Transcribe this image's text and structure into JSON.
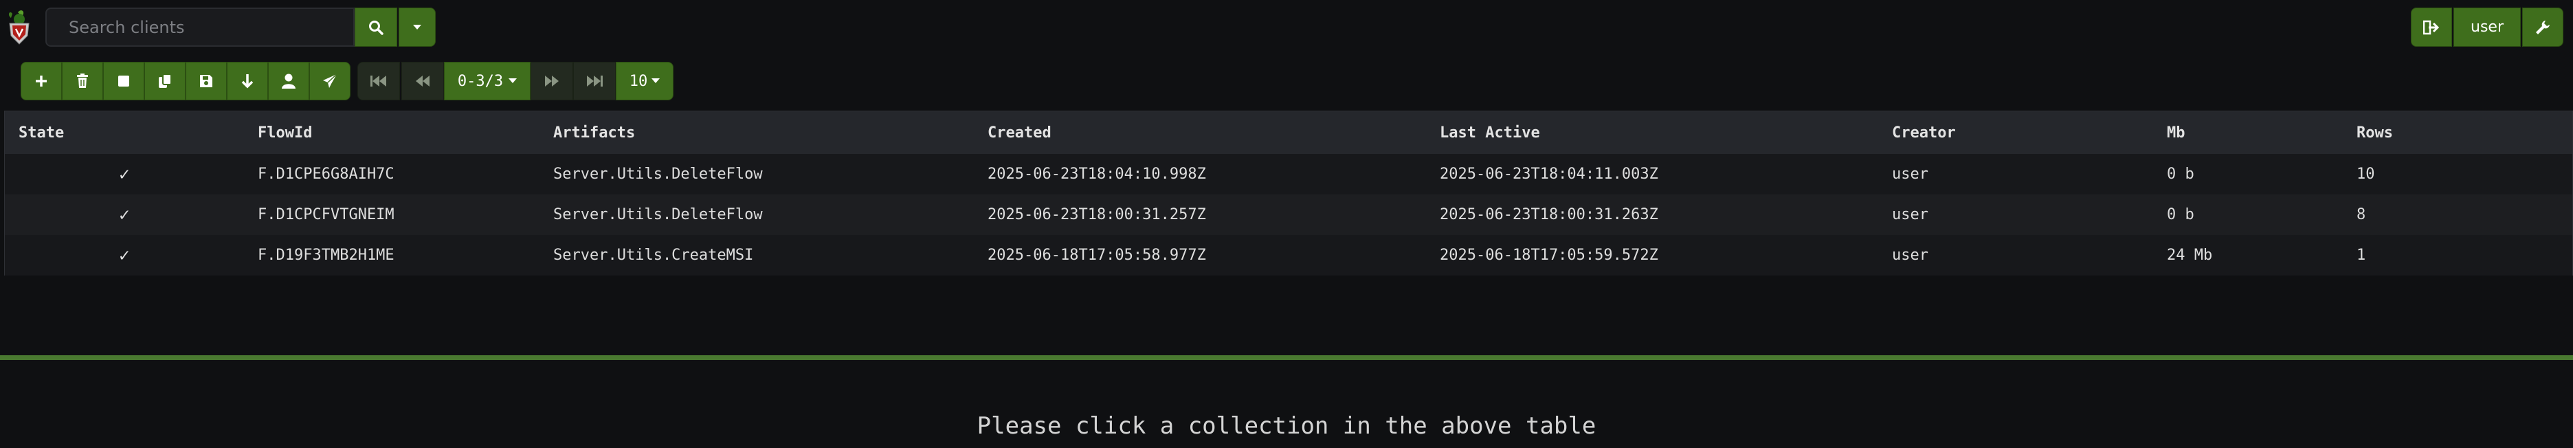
{
  "app": {
    "logo": "velociraptor-logo"
  },
  "search": {
    "placeholder": "Search clients"
  },
  "user": {
    "label": "user"
  },
  "pager": {
    "range": "0-3/3",
    "page_size": "10"
  },
  "table": {
    "columns": [
      "State",
      "FlowId",
      "Artifacts",
      "Created",
      "Last Active",
      "Creator",
      "Mb",
      "Rows"
    ],
    "rows": [
      {
        "state": "✓",
        "flow_id": "F.D1CPE6G8AIH7C",
        "artifacts": "Server.Utils.DeleteFlow",
        "created": "2025-06-23T18:04:10.998Z",
        "last_active": "2025-06-23T18:04:11.003Z",
        "creator": "user",
        "mb": "0 b",
        "rows": "10"
      },
      {
        "state": "✓",
        "flow_id": "F.D1CPCFVTGNEIM",
        "artifacts": "Server.Utils.DeleteFlow",
        "created": "2025-06-23T18:00:31.257Z",
        "last_active": "2025-06-23T18:00:31.263Z",
        "creator": "user",
        "mb": "0 b",
        "rows": "8"
      },
      {
        "state": "✓",
        "flow_id": "F.D19F3TMB2H1ME",
        "artifacts": "Server.Utils.CreateMSI",
        "created": "2025-06-18T17:05:58.977Z",
        "last_active": "2025-06-18T17:05:59.572Z",
        "creator": "user",
        "mb": "24 Mb",
        "rows": "1"
      }
    ]
  },
  "detail": {
    "message": "Please click a collection in the above table"
  },
  "colors": {
    "accent": "#3f6e1c",
    "divider": "#4a7a30",
    "background": "#0f1012"
  },
  "icons": [
    "search-icon",
    "chevron-down-icon",
    "sign-out-icon",
    "wrench-icon",
    "plus-icon",
    "trash-icon",
    "stop-icon",
    "copy-icon",
    "save-icon",
    "download-icon",
    "user-icon",
    "send-icon",
    "first-page-icon",
    "prev-page-icon",
    "next-page-icon",
    "last-page-icon"
  ]
}
